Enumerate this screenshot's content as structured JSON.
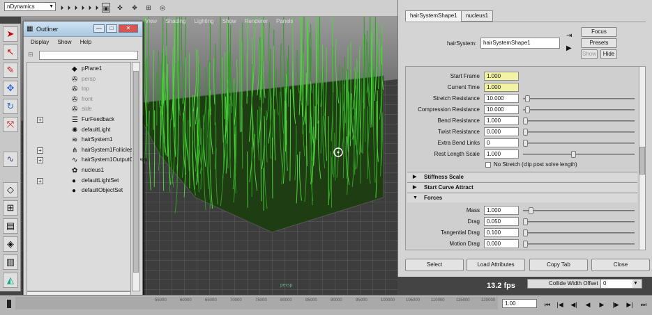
{
  "topbar": {
    "menu_set": "nDynamics"
  },
  "viewport": {
    "menu": [
      "View",
      "Shading",
      "Lighting",
      "Show",
      "Renderer",
      "Panels"
    ],
    "fps": "13.2 fps",
    "grid_label": "persp"
  },
  "outliner": {
    "title": "Outliner",
    "menu": [
      "Display",
      "Show",
      "Help"
    ],
    "items": [
      {
        "label": "pPlane1",
        "expandable": false,
        "dim": false,
        "icon": "mesh-icon"
      },
      {
        "label": "persp",
        "expandable": false,
        "dim": true,
        "icon": "camera-icon"
      },
      {
        "label": "top",
        "expandable": false,
        "dim": true,
        "icon": "camera-icon"
      },
      {
        "label": "front",
        "expandable": false,
        "dim": true,
        "icon": "camera-icon"
      },
      {
        "label": "side",
        "expandable": false,
        "dim": true,
        "icon": "camera-icon"
      },
      {
        "label": "FurFeedback",
        "expandable": true,
        "dim": false,
        "icon": "fur-icon"
      },
      {
        "label": "defaultLight",
        "expandable": false,
        "dim": false,
        "icon": "light-icon"
      },
      {
        "label": "hairSystem1",
        "expandable": false,
        "dim": false,
        "icon": "hair-icon"
      },
      {
        "label": "hairSystem1Follicles",
        "expandable": true,
        "dim": false,
        "icon": "follicle-icon"
      },
      {
        "label": "hairSystem1OutputCurves",
        "expandable": true,
        "dim": false,
        "icon": "curves-icon"
      },
      {
        "label": "nucleus1",
        "expandable": false,
        "dim": false,
        "icon": "nucleus-icon"
      },
      {
        "label": "defaultLightSet",
        "expandable": true,
        "dim": false,
        "icon": "set-icon"
      },
      {
        "label": "defaultObjectSet",
        "expandable": false,
        "dim": false,
        "icon": "set-icon"
      }
    ]
  },
  "attr_editor": {
    "tabs": [
      "hairSystemShape1",
      "nucleus1"
    ],
    "node_label": "hairSystem:",
    "node_value": "hairSystemShape1",
    "buttons": {
      "focus": "Focus",
      "presets": "Presets",
      "show": "Show",
      "hide": "Hide"
    },
    "rows": [
      {
        "label": "Start Frame",
        "value": "1.000",
        "yellow": true,
        "slider": null
      },
      {
        "label": "Current Time",
        "value": "1.000",
        "yellow": true,
        "slider": null
      },
      {
        "label": "Stretch Resistance",
        "value": "10.000",
        "yellow": false,
        "slider": 0.02
      },
      {
        "label": "Compression Resistance",
        "value": "10.000",
        "yellow": false,
        "slider": 0.02
      },
      {
        "label": "Bend Resistance",
        "value": "1.000",
        "yellow": false,
        "slider": 0.0
      },
      {
        "label": "Twist Resistance",
        "value": "0.000",
        "yellow": false,
        "slider": 0.0
      },
      {
        "label": "Extra Bend Links",
        "value": "0",
        "yellow": false,
        "slider": 0.0
      },
      {
        "label": "Rest Length Scale",
        "value": "1.000",
        "yellow": false,
        "slider": 0.45
      }
    ],
    "checkbox_label": "No Stretch (clip post solve length)",
    "sections": [
      {
        "label": "Stiffness Scale",
        "expanded": false
      },
      {
        "label": "Start Curve Attract",
        "expanded": false
      },
      {
        "label": "Forces",
        "expanded": true
      }
    ],
    "force_rows": [
      {
        "label": "Mass",
        "value": "1.000",
        "slider": 0.05
      },
      {
        "label": "Drag",
        "value": "0.050",
        "slider": 0.0
      },
      {
        "label": "Tangential Drag",
        "value": "0.100",
        "slider": 0.0
      },
      {
        "label": "Motion Drag",
        "value": "0.000",
        "slider": 0.0
      }
    ],
    "bottom_buttons": [
      "Select",
      "Load Attributes",
      "Copy Tab",
      "Close"
    ]
  },
  "collide": {
    "label": "Collide Width Offset",
    "value": "0"
  },
  "timeline": {
    "ticks": [
      "55000",
      "60000",
      "65000",
      "70000",
      "75000",
      "80000",
      "85000",
      "90000",
      "95000",
      "100000",
      "105000",
      "110000",
      "115000",
      "120000"
    ],
    "current_frame": "1.00"
  }
}
